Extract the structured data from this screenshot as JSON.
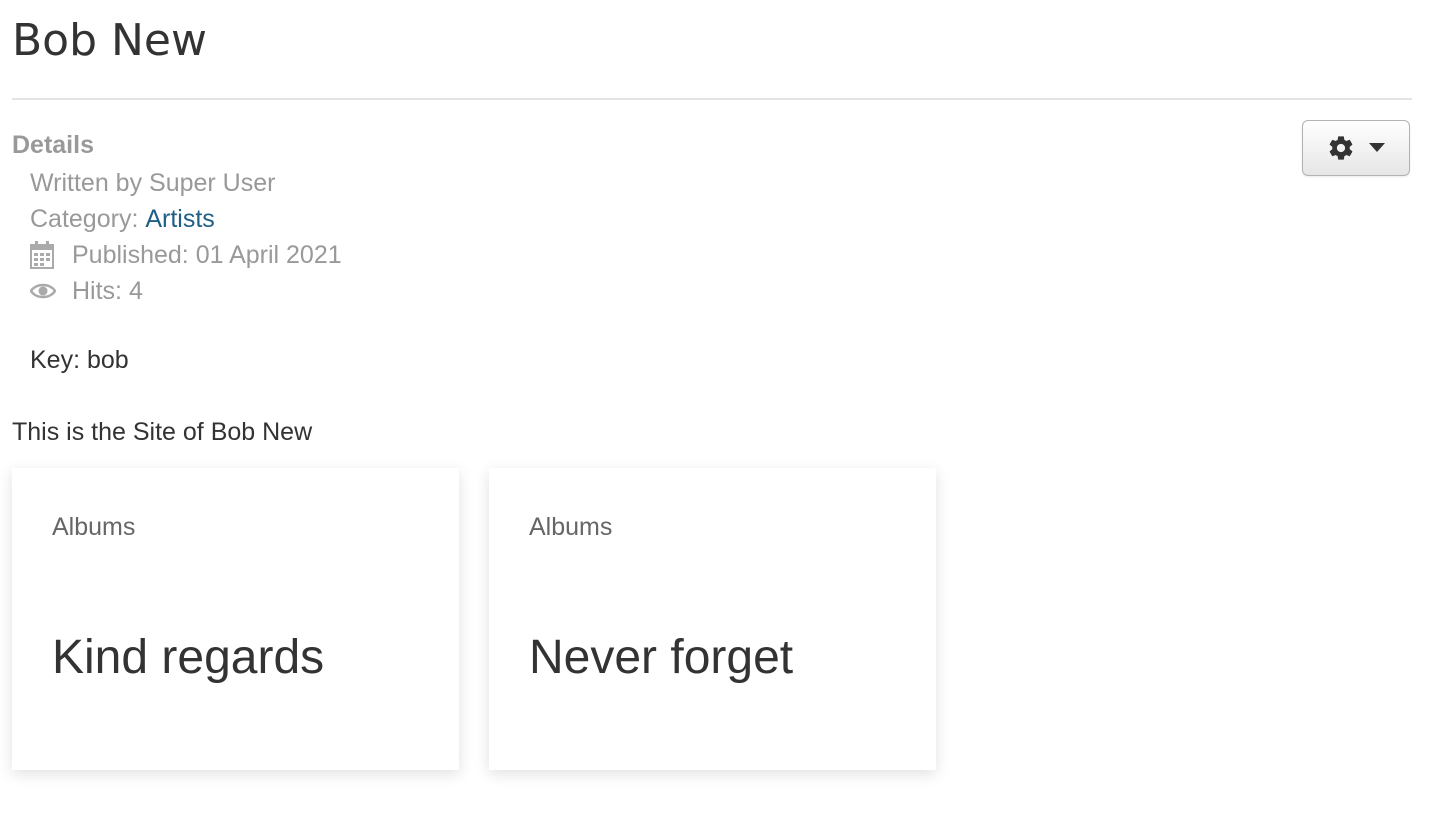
{
  "article": {
    "title": "Bob New",
    "details_heading": "Details",
    "written_by": "Written by Super User",
    "category_label": "Category:",
    "category_link": "Artists",
    "published": "Published: 01 April 2021",
    "hits": "Hits: 4",
    "key": "Key: bob",
    "intro": "This is the Site of Bob New"
  },
  "toolbar": {
    "tools_icon": "gear-icon",
    "caret_icon": "caret-down-icon"
  },
  "cards": [
    {
      "label": "Albums",
      "title": "Kind regards"
    },
    {
      "label": "Albums",
      "title": "Never forget"
    }
  ],
  "colors": {
    "link": "#1f5f86",
    "muted": "#999999",
    "text": "#333333"
  }
}
